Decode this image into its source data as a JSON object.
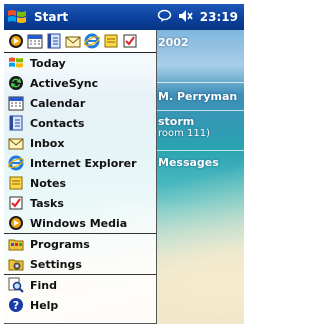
{
  "taskbar": {
    "title": "Start",
    "clock": "23:19"
  },
  "today": {
    "date_partial": "2002",
    "owner_partial": "M. Perryman",
    "appointment_title_partial": "storm",
    "appointment_location_partial": "room 111)",
    "messages_partial": "Messages"
  },
  "recent_programs": [
    "windows-media-icon",
    "calendar-icon",
    "contacts-icon",
    "inbox-icon",
    "internet-explorer-icon",
    "notes-icon",
    "tasks-icon"
  ],
  "menu": {
    "items": [
      {
        "label": "Today",
        "icon": "today-icon"
      },
      {
        "label": "ActiveSync",
        "icon": "activesync-icon"
      },
      {
        "label": "Calendar",
        "icon": "calendar-icon"
      },
      {
        "label": "Contacts",
        "icon": "contacts-icon"
      },
      {
        "label": "Inbox",
        "icon": "inbox-icon"
      },
      {
        "label": "Internet Explorer",
        "icon": "internet-explorer-icon"
      },
      {
        "label": "Notes",
        "icon": "notes-icon"
      },
      {
        "label": "Tasks",
        "icon": "tasks-icon"
      },
      {
        "label": "Windows Media",
        "icon": "windows-media-icon"
      }
    ],
    "programs_label": "Programs",
    "settings_label": "Settings",
    "find_label": "Find",
    "help_label": "Help"
  }
}
